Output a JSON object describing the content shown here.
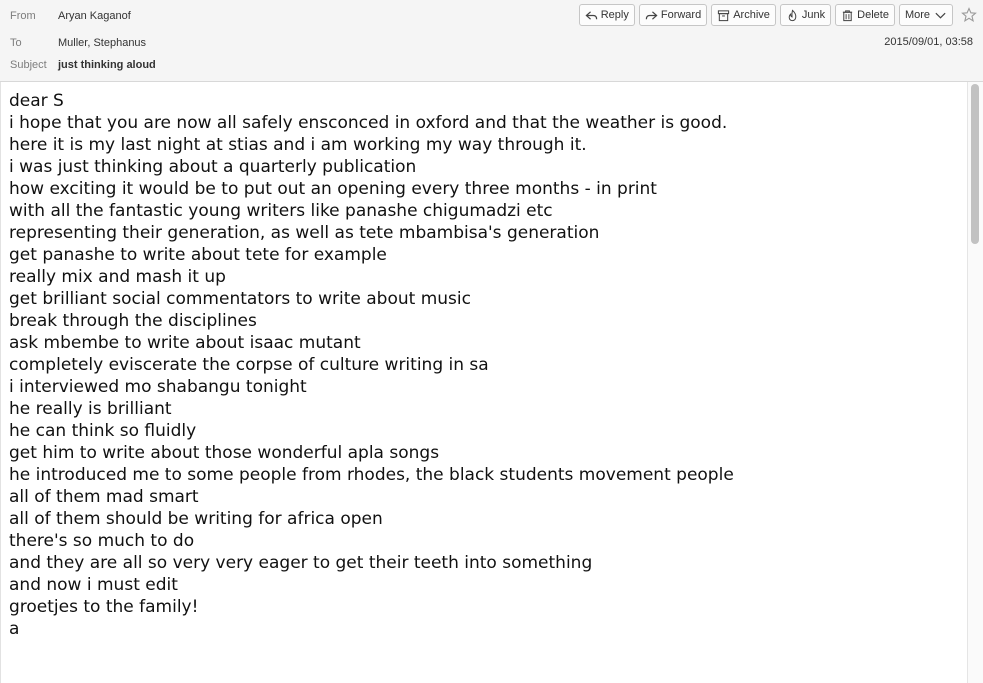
{
  "header": {
    "from_label": "From",
    "from_value": "Aryan Kaganof",
    "to_label": "To",
    "to_value": "Muller, Stephanus",
    "subject_label": "Subject",
    "subject_value": "just thinking aloud",
    "date": "2015/09/01, 03:58"
  },
  "toolbar": {
    "reply": {
      "label": "Reply",
      "icon": "reply-icon"
    },
    "forward": {
      "label": "Forward",
      "icon": "forward-icon"
    },
    "archive": {
      "label": "Archive",
      "icon": "archive-icon"
    },
    "junk": {
      "label": "Junk",
      "icon": "junk-icon"
    },
    "delete": {
      "label": "Delete",
      "icon": "trash-icon"
    },
    "more": {
      "label": "More",
      "icon": "chevron-down-icon"
    },
    "star": {
      "icon": "star-icon"
    }
  },
  "body_lines": [
    "dear S",
    "i hope that you are now all safely ensconced in oxford and that the weather is good.",
    "here it is my last night at stias and i am working my way through it.",
    "i was just thinking about a quarterly publication",
    "how exciting it would be to put out an opening every three months - in print",
    "with all the fantastic young writers like panashe chigumadzi etc",
    "representing their generation, as well as tete mbambisa's generation",
    "get panashe to write about tete for example",
    "really mix and mash it up",
    "get brilliant social commentators to write about music",
    "break through the disciplines",
    "ask mbembe to write about isaac mutant",
    "completely eviscerate the corpse of culture writing in sa",
    "i interviewed mo shabangu tonight",
    "he really is brilliant",
    "he can think so fluidly",
    "get him to write about those wonderful apla songs",
    "he introduced me to some people from rhodes, the black students movement people",
    "all of them mad smart",
    "all of them should be writing for africa open",
    "there's so much to do",
    "and they are all so very very eager to get their teeth into something",
    "and now i must edit",
    "groetjes to the family!",
    "a"
  ]
}
